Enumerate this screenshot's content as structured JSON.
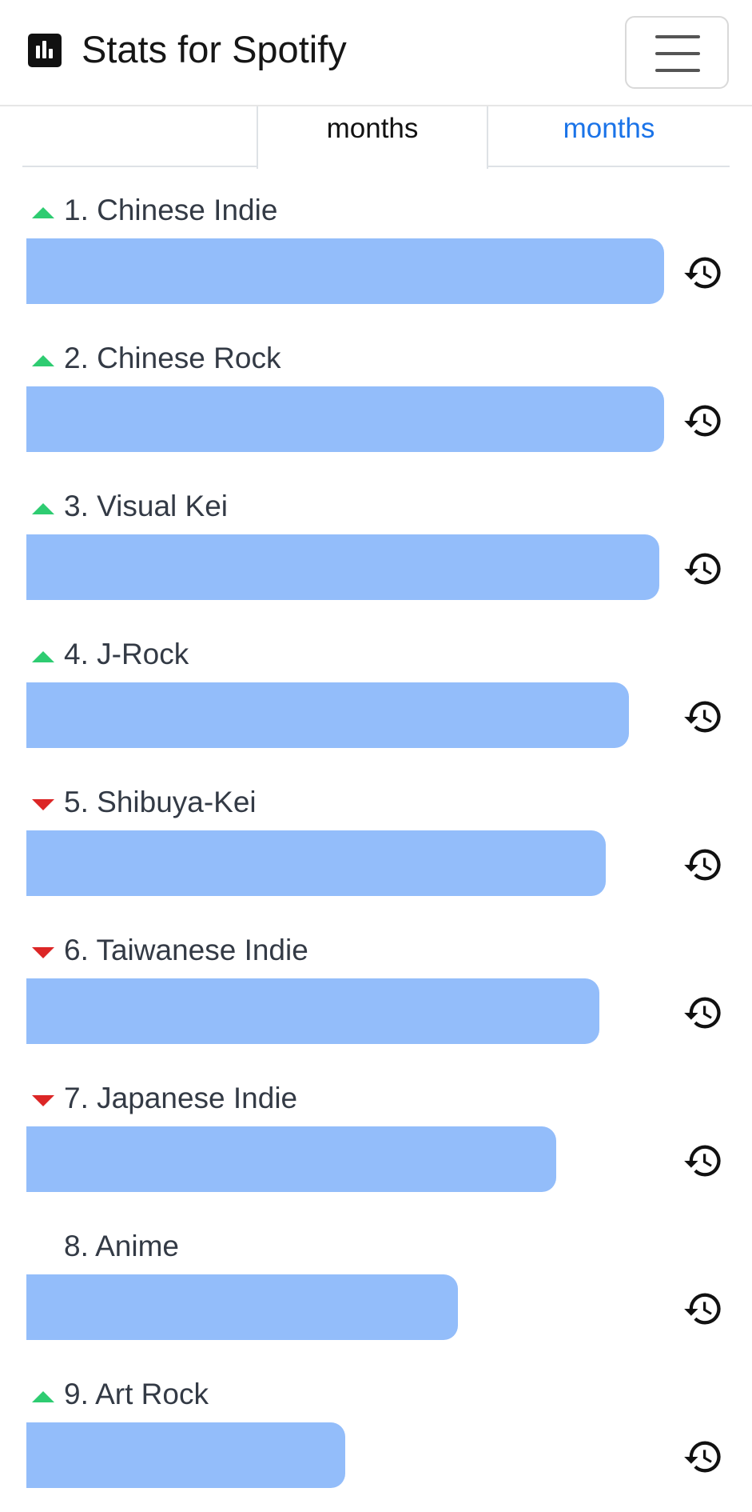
{
  "app": {
    "title": "Stats for Spotify",
    "brand_icon": "bar-chart-icon"
  },
  "nav": {
    "menu_icon": "hamburger-menu-icon"
  },
  "tabs": [
    {
      "label": "",
      "active": false
    },
    {
      "label": "months",
      "active": true
    },
    {
      "label": "months",
      "active": false
    }
  ],
  "colors": {
    "bar": "#93bdfa",
    "trend_up": "#2ecc71",
    "trend_down": "#dc2626",
    "link": "#1a73e8"
  },
  "genres": [
    {
      "label": "1. Chinese Indie",
      "trend": "up",
      "value": 1.0
    },
    {
      "label": "2. Chinese Rock",
      "trend": "up",
      "value": 1.0
    },
    {
      "label": "3. Visual Kei",
      "trend": "up",
      "value": 0.992
    },
    {
      "label": "4. J-Rock",
      "trend": "up",
      "value": 0.945
    },
    {
      "label": "5. Shibuya-Kei",
      "trend": "down",
      "value": 0.908
    },
    {
      "label": "6. Taiwanese Indie",
      "trend": "down",
      "value": 0.899
    },
    {
      "label": "7. Japanese Indie",
      "trend": "down",
      "value": 0.831
    },
    {
      "label": "8. Anime",
      "trend": "none",
      "value": 0.677
    },
    {
      "label": "9. Art Rock",
      "trend": "up",
      "value": 0.5
    }
  ],
  "row_action_icon": "history-icon"
}
